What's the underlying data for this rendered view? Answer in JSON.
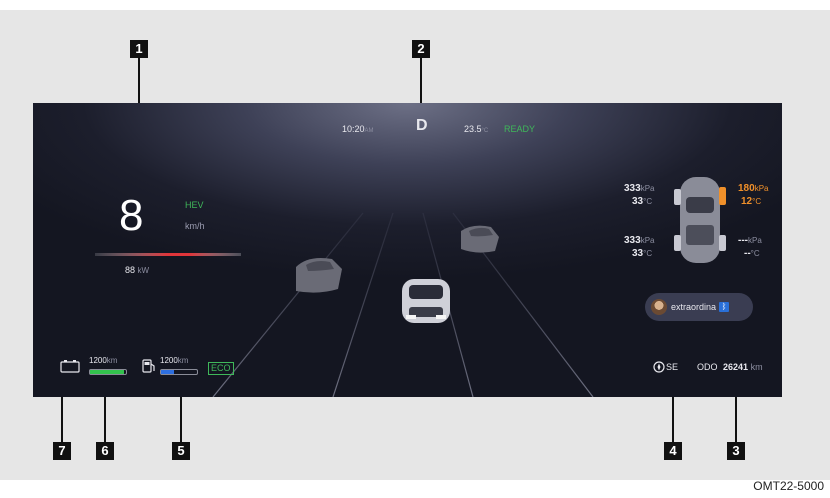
{
  "header": {
    "time": "10:20",
    "time_suffix": "AM",
    "gear": "D",
    "temperature": "23.5",
    "temperature_unit": "°C",
    "status": "READY"
  },
  "speed": {
    "value": "8",
    "mode": "HEV",
    "unit": "km/h",
    "power_value": "88",
    "power_unit": "kW"
  },
  "tires": {
    "front_left": {
      "pressure": "333",
      "pressure_unit": "kPa",
      "temp": "33",
      "temp_unit": "°C"
    },
    "front_right": {
      "pressure": "180",
      "pressure_unit": "kPa",
      "temp": "12",
      "temp_unit": "°C"
    },
    "rear_left": {
      "pressure": "333",
      "pressure_unit": "kPa",
      "temp": "33",
      "temp_unit": "°C"
    },
    "rear_right": {
      "pressure": "---",
      "pressure_unit": "kPa",
      "temp": "--",
      "temp_unit": "°C"
    }
  },
  "media": {
    "track": "extraordina"
  },
  "bottom": {
    "battery_range": "1200",
    "battery_range_unit": "km",
    "battery_level": 0.95,
    "fuel_range": "1200",
    "fuel_range_unit": "km",
    "fuel_level": 0.35,
    "eco": "ECO",
    "compass": "SE",
    "odo_label": "ODO",
    "odo_value": "26241",
    "odo_unit": "km"
  },
  "callouts": [
    "1",
    "2",
    "3",
    "4",
    "5",
    "6",
    "7"
  ],
  "figure_code": "OMT22-5000",
  "colors": {
    "screen_bg": "#1c1e2c",
    "ready_green": "#3fb85a",
    "warning_orange": "#f0902a",
    "power_red": "#e0353a",
    "battery_green": "#33c24d",
    "fuel_blue": "#2e6fe0",
    "bluetooth_blue": "#2a70d8"
  },
  "icons": [
    "battery-icon",
    "fuel-pump-icon",
    "compass-icon",
    "bluetooth-icon",
    "user-avatar-icon"
  ]
}
